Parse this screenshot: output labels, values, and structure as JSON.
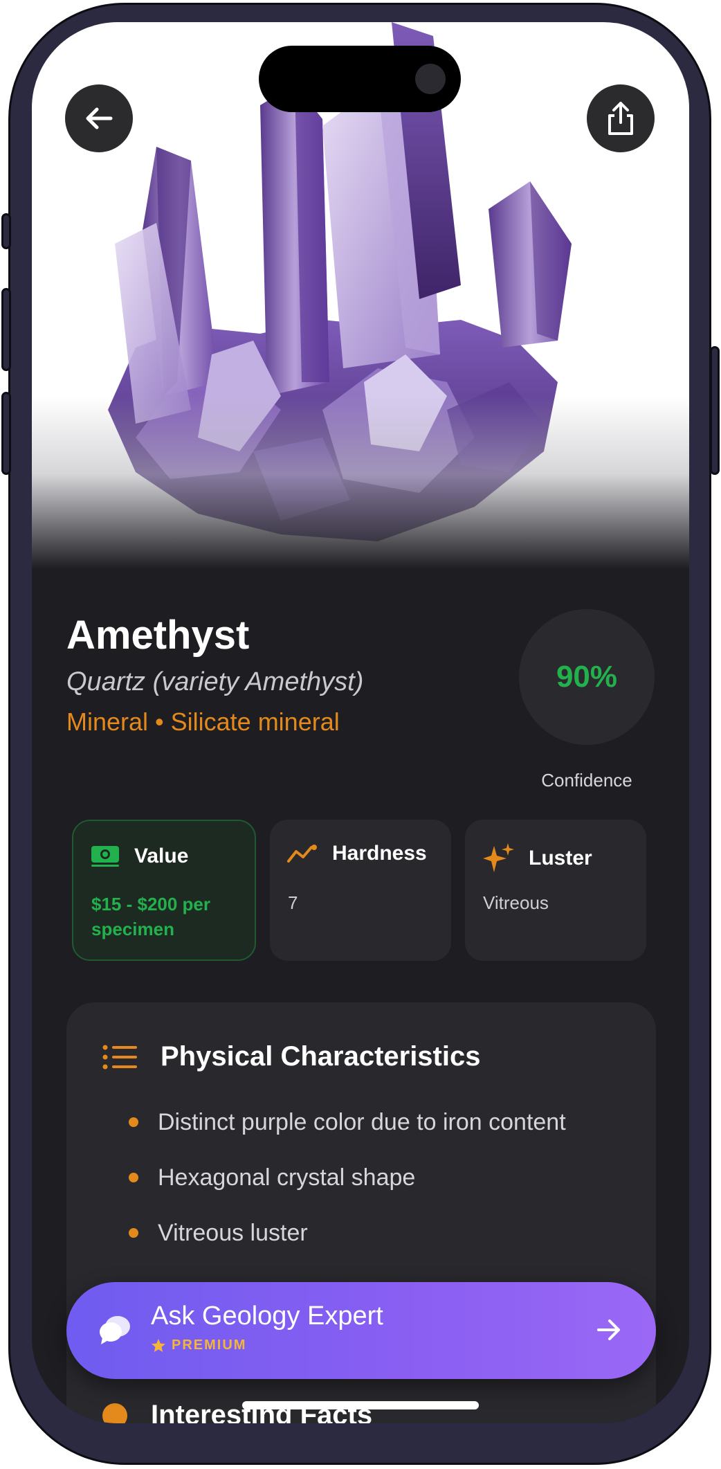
{
  "header": {
    "back_icon": "arrow-left-icon",
    "share_icon": "share-icon",
    "hero_image": "amethyst crystal cluster illustration"
  },
  "specimen": {
    "name": "Amethyst",
    "scientific_name": "Quartz (variety Amethyst)",
    "category": "Mineral • Silicate mineral",
    "confidence_value": "90%",
    "confidence_label": "Confidence"
  },
  "properties": [
    {
      "icon": "money-icon",
      "label": "Value",
      "value": "$15 - $200 per specimen"
    },
    {
      "icon": "trend-line-icon",
      "label": "Hardness",
      "value": "7"
    },
    {
      "icon": "sparkle-icon",
      "label": "Luster",
      "value": "Vitreous"
    }
  ],
  "physical": {
    "icon": "list-icon",
    "title": "Physical Characteristics",
    "items": [
      "Distinct purple color due to iron content",
      "Hexagonal crystal shape",
      "Vitreous luster"
    ]
  },
  "facts": {
    "title": "Interesting Facts"
  },
  "cta": {
    "icon": "chat-bubbles-icon",
    "title": "Ask Geology Expert",
    "badge": "PREMIUM",
    "badge_icon": "star-icon",
    "arrow_icon": "arrow-right-icon"
  },
  "colors": {
    "accent_orange": "#e48a1c",
    "confidence_green": "#22b14c",
    "cta_purple": "#7b5ef1",
    "background": "#1e1d22"
  }
}
